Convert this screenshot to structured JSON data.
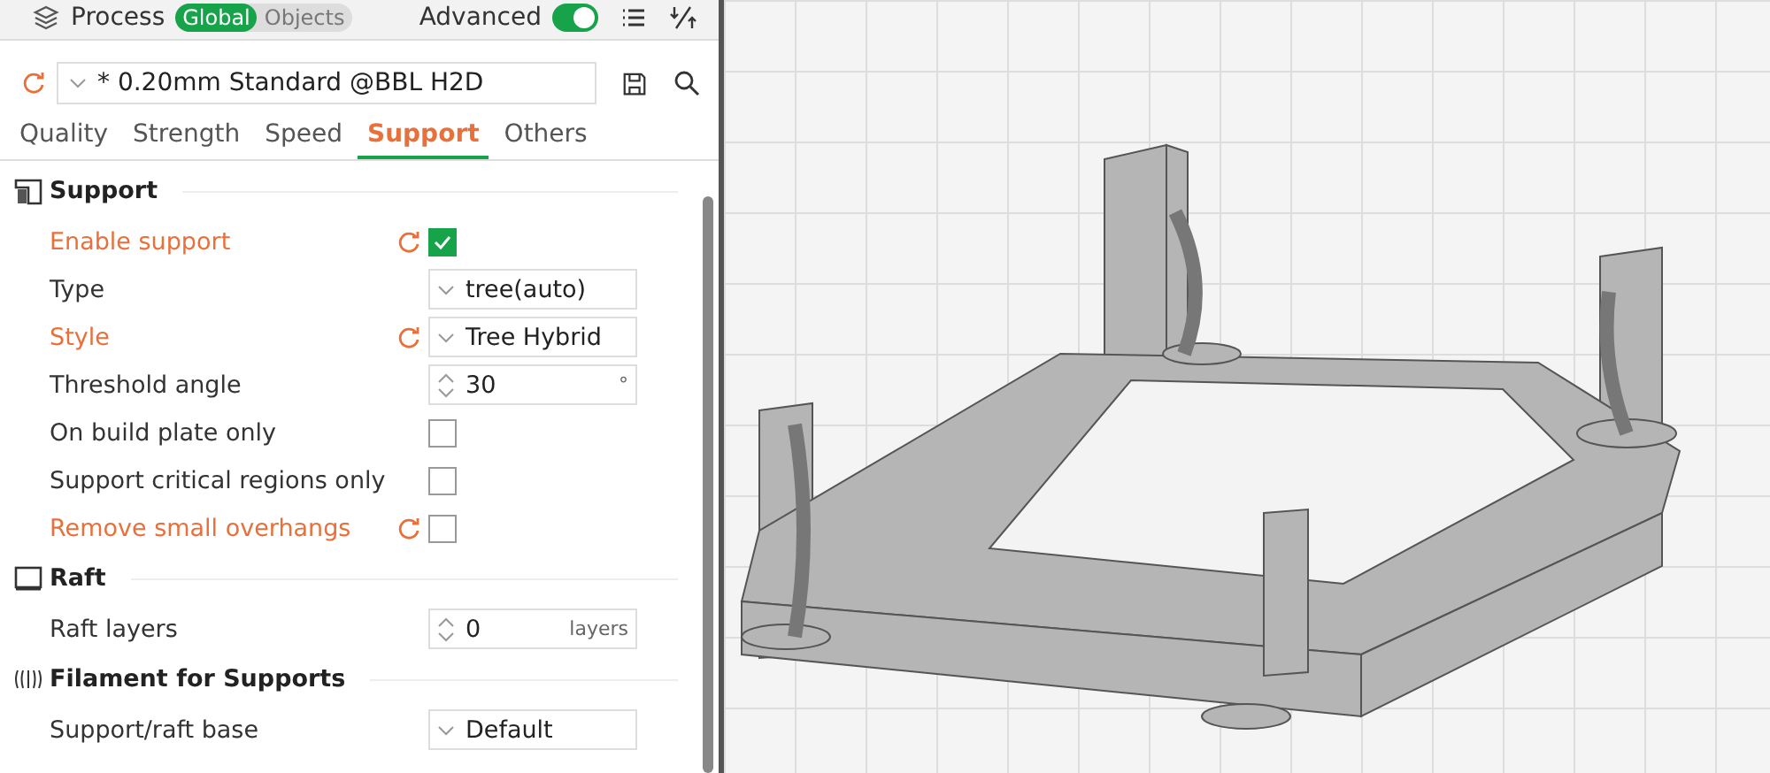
{
  "header": {
    "title": "Process",
    "modes": [
      {
        "label": "Global",
        "selected": true
      },
      {
        "label": "Objects",
        "selected": false
      }
    ],
    "advanced": {
      "label": "Advanced",
      "on": true
    }
  },
  "preset": {
    "value": "* 0.20mm Standard @BBL H2D"
  },
  "tabs": [
    {
      "label": "Quality",
      "selected": false
    },
    {
      "label": "Strength",
      "selected": false
    },
    {
      "label": "Speed",
      "selected": false
    },
    {
      "label": "Support",
      "selected": true
    },
    {
      "label": "Others",
      "selected": false
    }
  ],
  "sections": [
    {
      "kind": "support",
      "title": "Support",
      "settings": [
        {
          "label": "Enable support",
          "kind": "checkbox",
          "checked": true,
          "modified": true
        },
        {
          "label": "Type",
          "kind": "dropdown",
          "value": "tree(auto)",
          "modified": false
        },
        {
          "label": "Style",
          "kind": "dropdown",
          "value": "Tree Hybrid",
          "modified": true
        },
        {
          "label": "Threshold angle",
          "kind": "spin",
          "value": "30",
          "unit": "°",
          "modified": false
        },
        {
          "label": "On build plate only",
          "kind": "checkbox",
          "checked": false,
          "modified": false
        },
        {
          "label": "Support critical regions only",
          "kind": "checkbox",
          "checked": false,
          "modified": false
        },
        {
          "label": "Remove small overhangs",
          "kind": "checkbox",
          "checked": false,
          "modified": true
        }
      ]
    },
    {
      "kind": "raft",
      "title": "Raft",
      "settings": [
        {
          "label": "Raft layers",
          "kind": "spin",
          "value": "0",
          "unit": "layers",
          "modified": false
        }
      ]
    },
    {
      "kind": "filament",
      "title": "Filament for Supports",
      "settings": [
        {
          "label": "Support/raft base",
          "kind": "dropdown",
          "value": "Default",
          "modified": false
        }
      ]
    }
  ]
}
